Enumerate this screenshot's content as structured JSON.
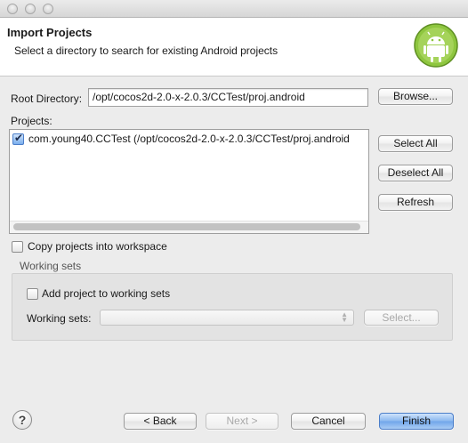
{
  "banner": {
    "title": "Import Projects",
    "description": "Select a directory to search for existing Android projects"
  },
  "root_directory": {
    "label": "Root Directory:",
    "value": "/opt/cocos2d-2.0-x-2.0.3/CCTest/proj.android",
    "browse_label": "Browse..."
  },
  "projects": {
    "label": "Projects:",
    "items": [
      {
        "text": "com.young40.CCTest (/opt/cocos2d-2.0-x-2.0.3/CCTest/proj.android",
        "checked": true
      }
    ],
    "select_all_label": "Select All",
    "deselect_all_label": "Deselect All",
    "refresh_label": "Refresh"
  },
  "copy_projects": {
    "label": "Copy projects into workspace",
    "checked": false
  },
  "working_sets": {
    "group_label": "Working sets",
    "add_label": "Add project to working sets",
    "add_checked": false,
    "field_label": "Working sets:",
    "select_value": "",
    "select_button_label": "Select..."
  },
  "footer": {
    "help_glyph": "?",
    "back_label": "< Back",
    "next_label": "Next >",
    "cancel_label": "Cancel",
    "finish_label": "Finish"
  },
  "icons": {
    "wizard": "android-robot-icon",
    "help": "help-icon",
    "dropdown": "updown-arrows-icon"
  },
  "colors": {
    "android_green": "#8ec63f",
    "default_button": "#6fa5ea",
    "window_bg": "#ececec"
  }
}
